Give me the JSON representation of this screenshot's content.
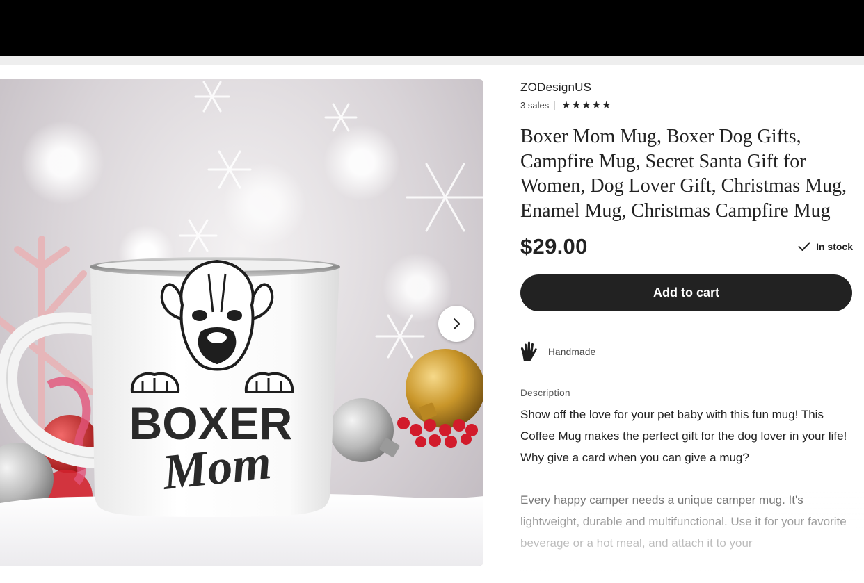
{
  "listing": {
    "shop_name": "ZODesignUS",
    "sales": "3 sales",
    "rating_stars": 5,
    "star_glyph": "★",
    "title": "Boxer Mom Mug, Boxer Dog Gifts, Campfire Mug, Secret Santa Gift for Women, Dog Lover Gift, Christmas Mug, Enamel Mug, Christmas Campfire Mug",
    "price": "$29.00",
    "stock_text": "In stock",
    "add_to_cart": "Add to cart",
    "handmade": "Handmade",
    "description_label": "Description",
    "description_p1": "Show off the love for your pet baby with this fun mug! This Coffee Mug makes the perfect gift for the dog lover in your life! Why give a card when you can give a mug?",
    "description_p2": "Every happy camper needs a unique camper mug. It's lightweight, durable and multifunctional. Use it for your favorite beverage or a hot meal, and attach it to your"
  },
  "photo": {
    "mug_print_line1": "BOXER",
    "mug_print_line2": "Mom",
    "next_icon": "chevron-right-icon"
  },
  "colors": {
    "button_bg": "#222222",
    "top_bar": "#000000",
    "ornament_gold": "#c9962a",
    "ornament_red": "#c81a2a"
  }
}
